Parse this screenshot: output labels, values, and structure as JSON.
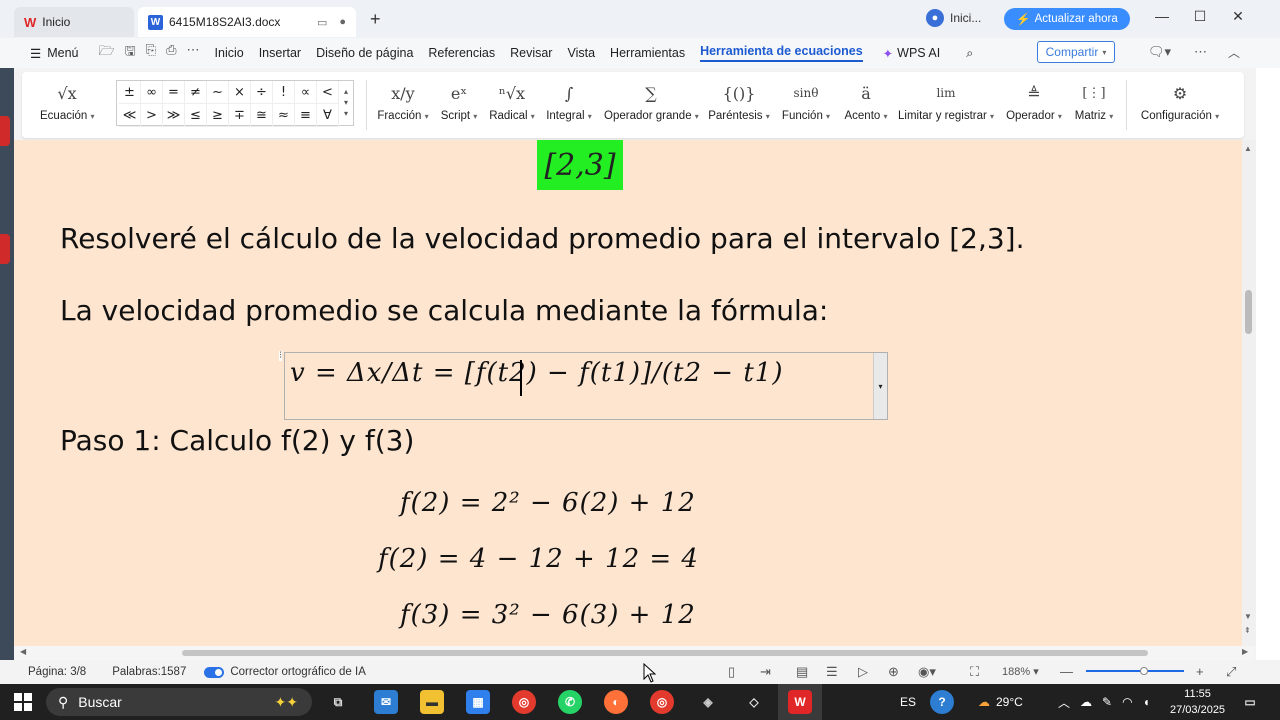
{
  "tabs": {
    "home_label": "Inicio",
    "doc_label": "6415M18S2AI3.docx",
    "account_label": "Inici...",
    "upgrade_label": "Actualizar ahora"
  },
  "menubar": {
    "menu_label": "Menú",
    "items": [
      "Inicio",
      "Insertar",
      "Diseño de página",
      "Referencias",
      "Revisar",
      "Vista",
      "Herramientas",
      "Herramienta de ecuaciones"
    ],
    "wps_ai": "WPS AI",
    "share_label": "Compartir"
  },
  "ribbon": {
    "equation": "Ecuación",
    "symbols": [
      "±",
      "∞",
      "=",
      "≠",
      "~",
      "×",
      "÷",
      "!",
      "∝",
      "<",
      "≪",
      ">",
      "≫",
      "≤",
      "≥",
      "∓",
      "≅",
      "≈",
      "≡",
      "∀"
    ],
    "tools": [
      {
        "label": "Fracción",
        "icon": "x/y"
      },
      {
        "label": "Script",
        "icon": "eˣ"
      },
      {
        "label": "Radical",
        "icon": "ⁿ√x"
      },
      {
        "label": "Integral",
        "icon": "∫"
      },
      {
        "label": "Operador grande",
        "icon": "∑"
      },
      {
        "label": "Paréntesis",
        "icon": "{()}"
      },
      {
        "label": "Función",
        "icon": "sinθ"
      },
      {
        "label": "Acento",
        "icon": "ä"
      },
      {
        "label": "Limitar y registrar",
        "icon": "lim"
      },
      {
        "label": "Operador",
        "icon": "≜"
      },
      {
        "label": "Matriz",
        "icon": "[⋮]"
      },
      {
        "label": "Configuración",
        "icon": "⚙"
      }
    ]
  },
  "document": {
    "interval_box": "[2,3]",
    "line1": "Resolveré el cálculo de la velocidad promedio para el intervalo [2,3].",
    "line2": "La velocidad promedio se calcula mediante la fórmula:",
    "formula": "v  =  Δx/Δt  =  [f(t2)  −  f(t1)]/(t2  −  t1)",
    "step1": "Paso 1: Calculo f(2) y f(3)",
    "eq1": "f(2)  =  2²  −  6(2)  +  12",
    "eq2": "f(2)  =  4  −  12  +  12  =  4",
    "eq3": "f(3)  =  3²  −  6(3)  +  12"
  },
  "statusbar": {
    "page": "Página: 3/8",
    "words": "Palabras:1587",
    "spell": "Corrector ortográfico de IA",
    "zoom": "188%"
  },
  "taskbar": {
    "search_placeholder": "Buscar",
    "lang": "ES",
    "weather": "29°C",
    "time": "11:55",
    "date": "27/03/2025"
  },
  "colors": {
    "accent": "#1d5bd1",
    "doc_background": "#fde5d0",
    "highlight": "#22ee22",
    "upgrade": "#3a8dff"
  }
}
